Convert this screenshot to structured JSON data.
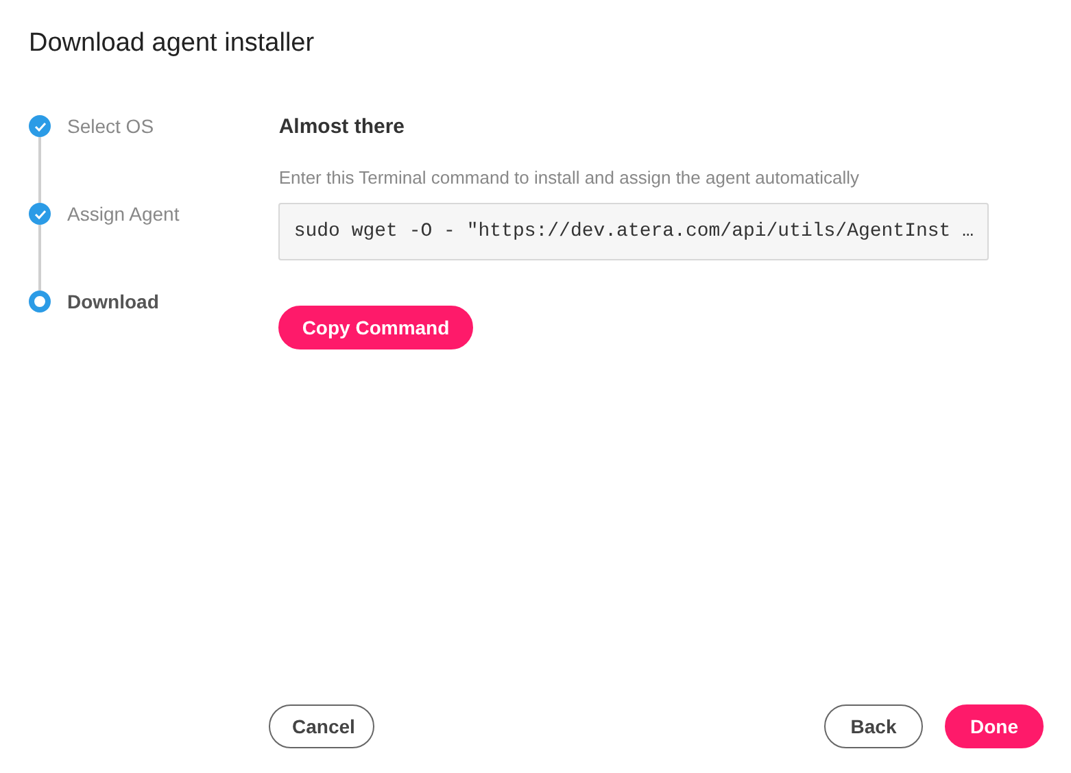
{
  "dialog": {
    "title": "Download agent installer"
  },
  "steps": [
    {
      "label": "Select OS",
      "completed": true,
      "selected": false
    },
    {
      "label": "Assign Agent",
      "completed": true,
      "selected": false
    },
    {
      "label": "Download",
      "completed": false,
      "selected": true
    }
  ],
  "content": {
    "heading": "Almost there",
    "instruction": "Enter this Terminal command to install and assign the agent automatically",
    "command": "sudo wget -O - \"https://dev.atera.com/api/utils/AgentInst …",
    "copy_button": "Copy Command"
  },
  "footer": {
    "cancel": "Cancel",
    "back": "Back",
    "done": "Done"
  }
}
